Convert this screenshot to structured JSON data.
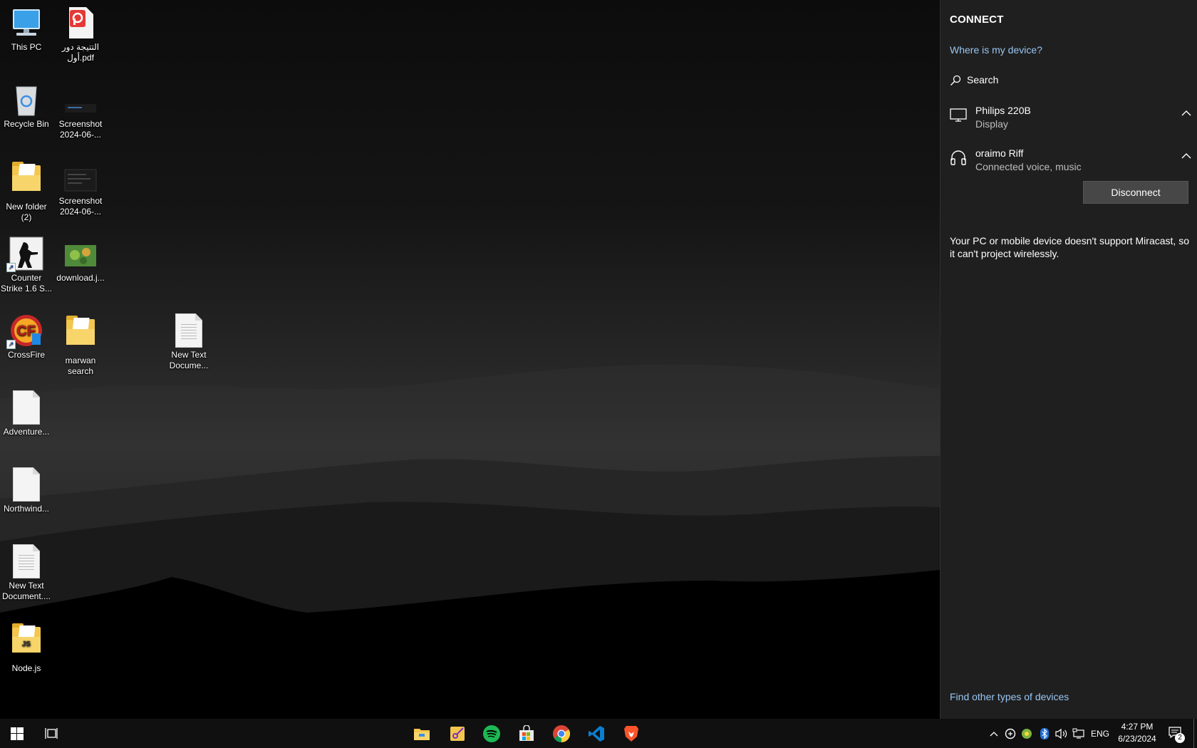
{
  "desktop": {
    "icons": [
      {
        "label": "This PC"
      },
      {
        "label": "التتيجة دور\nأول.pdf"
      },
      {
        "label": "Recycle Bin"
      },
      {
        "label": "Screenshot\n2024-06-..."
      },
      {
        "label": "New folder\n(2)"
      },
      {
        "label": "Screenshot\n2024-06-..."
      },
      {
        "label": "Counter\nStrike 1.6 S..."
      },
      {
        "label": "download.j..."
      },
      {
        "label": "CrossFire"
      },
      {
        "label": "marwan\nsearch"
      },
      {
        "label": "New Text\nDocume..."
      },
      {
        "label": "Adventure..."
      },
      {
        "label": "Northwind..."
      },
      {
        "label": "New Text\nDocument...."
      },
      {
        "label": "Node.js"
      }
    ]
  },
  "connect_panel": {
    "title": "CONNECT",
    "where_link": "Where is my device?",
    "search_label": "Search",
    "devices": [
      {
        "name": "Philips 220B",
        "status": "Display",
        "icon": "monitor-icon"
      },
      {
        "name": "oraimo Riff",
        "status": "Connected voice, music",
        "icon": "headphones-icon"
      }
    ],
    "disconnect_label": "Disconnect",
    "miracast_message": "Your PC or mobile device doesn't support Miracast, so it can't project wirelessly.",
    "find_other_link": "Find other types of devices"
  },
  "taskbar": {
    "apps": [
      "file-explorer-icon",
      "snipping-tool-icon",
      "spotify-icon",
      "microsoft-store-icon",
      "chrome-icon",
      "vscode-icon",
      "brave-icon"
    ],
    "language": "ENG",
    "time": "4:27 PM",
    "date": "6/23/2024",
    "notification_count": "2"
  },
  "colors": {
    "panel_bg": "#1f1f1f",
    "link": "#99c6f2",
    "taskbar_bg": "#101010"
  }
}
